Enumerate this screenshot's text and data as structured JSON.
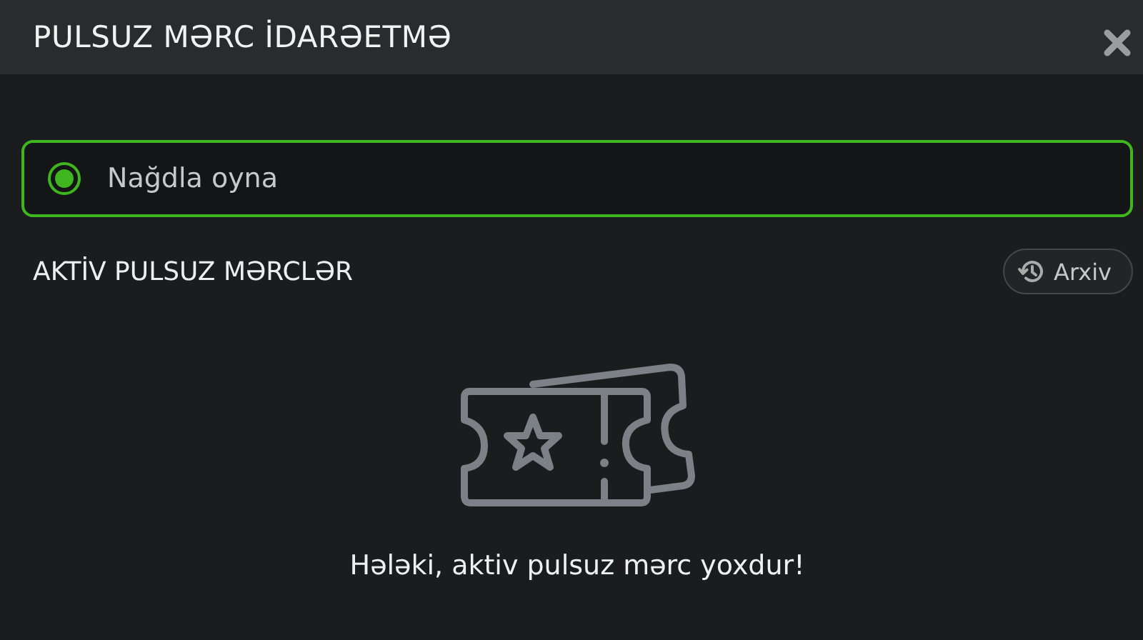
{
  "window": {
    "title": "PULSUZ MƏRC İDARƏETMƏ"
  },
  "options": [
    {
      "label": "Nağdla oyna",
      "selected": true
    }
  ],
  "section": {
    "title": "AKTİV PULSUZ MƏRCLƏR",
    "archive_button": "Arxiv"
  },
  "empty_message": "Hələki, aktiv pulsuz mərc yoxdur!"
}
